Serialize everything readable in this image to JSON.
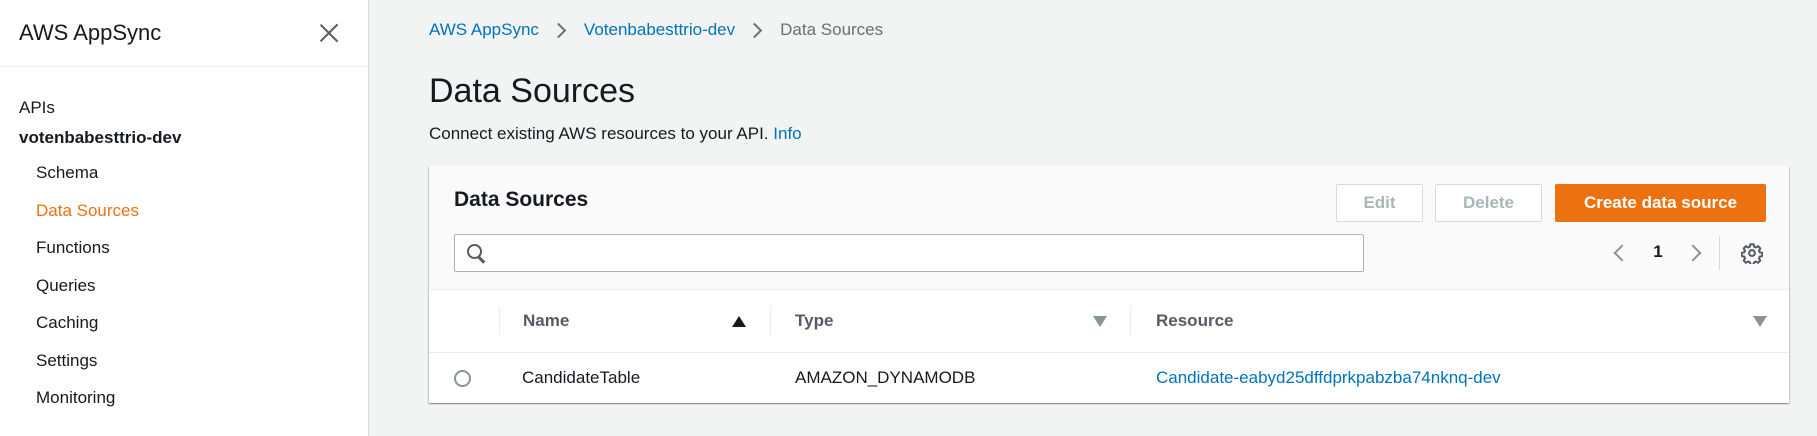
{
  "sidebar": {
    "title": "AWS AppSync",
    "apis_label": "APIs",
    "api_name": "votenbabesttrio-dev",
    "items": [
      {
        "label": "Schema"
      },
      {
        "label": "Data Sources"
      },
      {
        "label": "Functions"
      },
      {
        "label": "Queries"
      },
      {
        "label": "Caching"
      },
      {
        "label": "Settings"
      },
      {
        "label": "Monitoring"
      }
    ],
    "active_item": "Data Sources"
  },
  "breadcrumb": [
    "AWS AppSync",
    "Votenbabesttrio-dev",
    "Data Sources"
  ],
  "page": {
    "title": "Data Sources",
    "description": "Connect existing AWS resources to your API.",
    "info_link": "Info"
  },
  "panel": {
    "title": "Data Sources",
    "buttons": {
      "edit": "Edit",
      "delete": "Delete",
      "create": "Create data source"
    },
    "search": {
      "placeholder": "",
      "value": ""
    },
    "pagination": {
      "current_page": "1"
    }
  },
  "table": {
    "columns": [
      "Name",
      "Type",
      "Resource"
    ],
    "sorted_column": "Name",
    "rows": [
      {
        "name": "CandidateTable",
        "type": "AMAZON_DYNAMODB",
        "resource": "Candidate-eabyd25dffdprkpabzba74nknq-dev",
        "selected": false
      }
    ]
  },
  "colors": {
    "accent_orange": "#ec7211",
    "link_blue": "#0073bb",
    "page_background": "#f2f3f3"
  },
  "icons": [
    "close-icon",
    "chevron-right-icon",
    "search-icon",
    "chevron-left-icon",
    "gear-icon",
    "sort-ascending-icon",
    "sort-descending-icon"
  ]
}
